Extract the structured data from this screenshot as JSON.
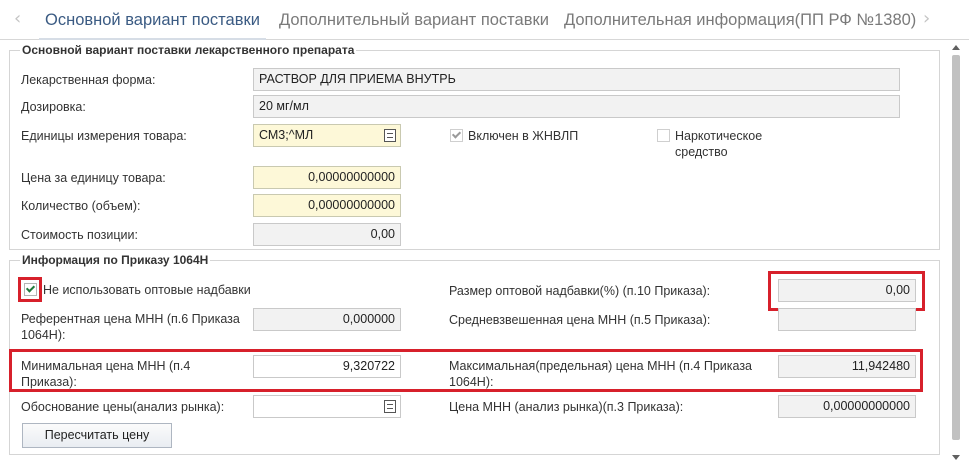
{
  "tabs": {
    "main": "Основной вариант поставки",
    "additional": "Дополнительный вариант поставки",
    "info": "Дополнительная информация(ПП РФ №1380)"
  },
  "drug_section": {
    "legend": "Основной вариант поставки лекарственного препарата",
    "form_label": "Лекарственная форма:",
    "form_value": "РАСТВОР ДЛЯ ПРИЕМА ВНУТРЬ",
    "dosage_label": "Дозировка:",
    "dosage_value": "20 мг/мл",
    "units_label": "Единицы измерения товара:",
    "units_value": "СМ3;^МЛ",
    "zhnvlp_label": "Включен в ЖНВЛП",
    "zhnvlp_checked": true,
    "narcotic_label": "Наркотическое средство",
    "narcotic_checked": false,
    "unit_price_label": "Цена за единицу товара:",
    "unit_price_value": "0,00000000000",
    "quantity_label": "Количество (объем):",
    "quantity_value": "0,00000000000",
    "cost_label": "Стоимость позиции:",
    "cost_value": "0,00"
  },
  "order_section": {
    "legend": "Информация по Приказу 1064Н",
    "no_wholesale_label": "Не использовать оптовые надбавки",
    "no_wholesale_checked": true,
    "wholesale_markup_label": "Размер оптовой надбавки(%) (п.10 Приказа):",
    "wholesale_markup_value": "0,00",
    "reference_price_label": "Референтная цена МНН (п.6 Приказа 1064Н):",
    "reference_price_value": "0,000000",
    "weighted_price_label": "Средневзвешенная цена МНН (п.5 Приказа):",
    "weighted_price_value": "",
    "min_price_label": "Минимальная цена МНН (п.4 Приказа):",
    "min_price_value": "9,320722",
    "max_price_label": "Максимальная(предельная) цена МНН (п.4 Приказа 1064Н):",
    "max_price_value": "11,942480",
    "justification_label": "Обоснование цены(анализ рынка):",
    "justification_value": "",
    "market_price_label": "Цена МНН (анализ рынка)(п.3 Приказа):",
    "market_price_value": "0,00000000000",
    "recalc_button": "Пересчитать цену"
  },
  "colors": {
    "highlight": "#d7202b",
    "required_field": "#fdf8d8",
    "readonly_field": "#f2f2f2",
    "active_tab": "#3b5b83"
  }
}
